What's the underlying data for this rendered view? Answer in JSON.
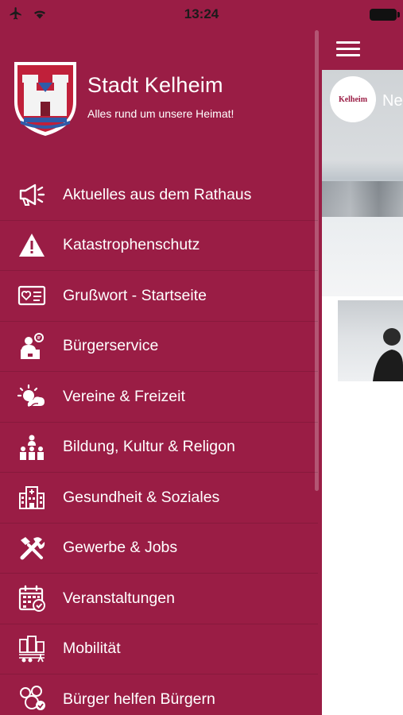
{
  "status_bar": {
    "time": "13:24",
    "icons": [
      "airplane-icon",
      "wifi-icon",
      "battery-icon"
    ]
  },
  "header": {
    "title": "Stadt Kelheim",
    "subtitle": "Alles rund um unsere Heimat!",
    "logo": "kelheim-coat-of-arms"
  },
  "menu": [
    {
      "label": "Aktuelles aus dem Rathaus",
      "icon": "megaphone-icon"
    },
    {
      "label": "Katastrophenschutz",
      "icon": "warning-icon"
    },
    {
      "label": "Grußwort - Startseite",
      "icon": "greeting-card-icon"
    },
    {
      "label": "Bürgerservice",
      "icon": "citizen-service-icon"
    },
    {
      "label": "Vereine & Freizeit",
      "icon": "sun-cloud-icon"
    },
    {
      "label": "Bildung, Kultur & Religon",
      "icon": "people-group-icon"
    },
    {
      "label": "Gesundheit & Soziales",
      "icon": "hospital-building-icon"
    },
    {
      "label": "Gewerbe & Jobs",
      "icon": "tools-icon"
    },
    {
      "label": "Veranstaltungen",
      "icon": "calendar-icon"
    },
    {
      "label": "Mobilität",
      "icon": "city-mobility-icon"
    },
    {
      "label": "Bürger helfen Bürgern",
      "icon": "helping-hands-icon"
    }
  ],
  "background_screen": {
    "logo_text": "Kelheim",
    "partial_heading": "Ne",
    "menu_icon": "hamburger-menu-icon"
  },
  "colors": {
    "primary": "#9a1d45",
    "text": "#ffffff"
  }
}
